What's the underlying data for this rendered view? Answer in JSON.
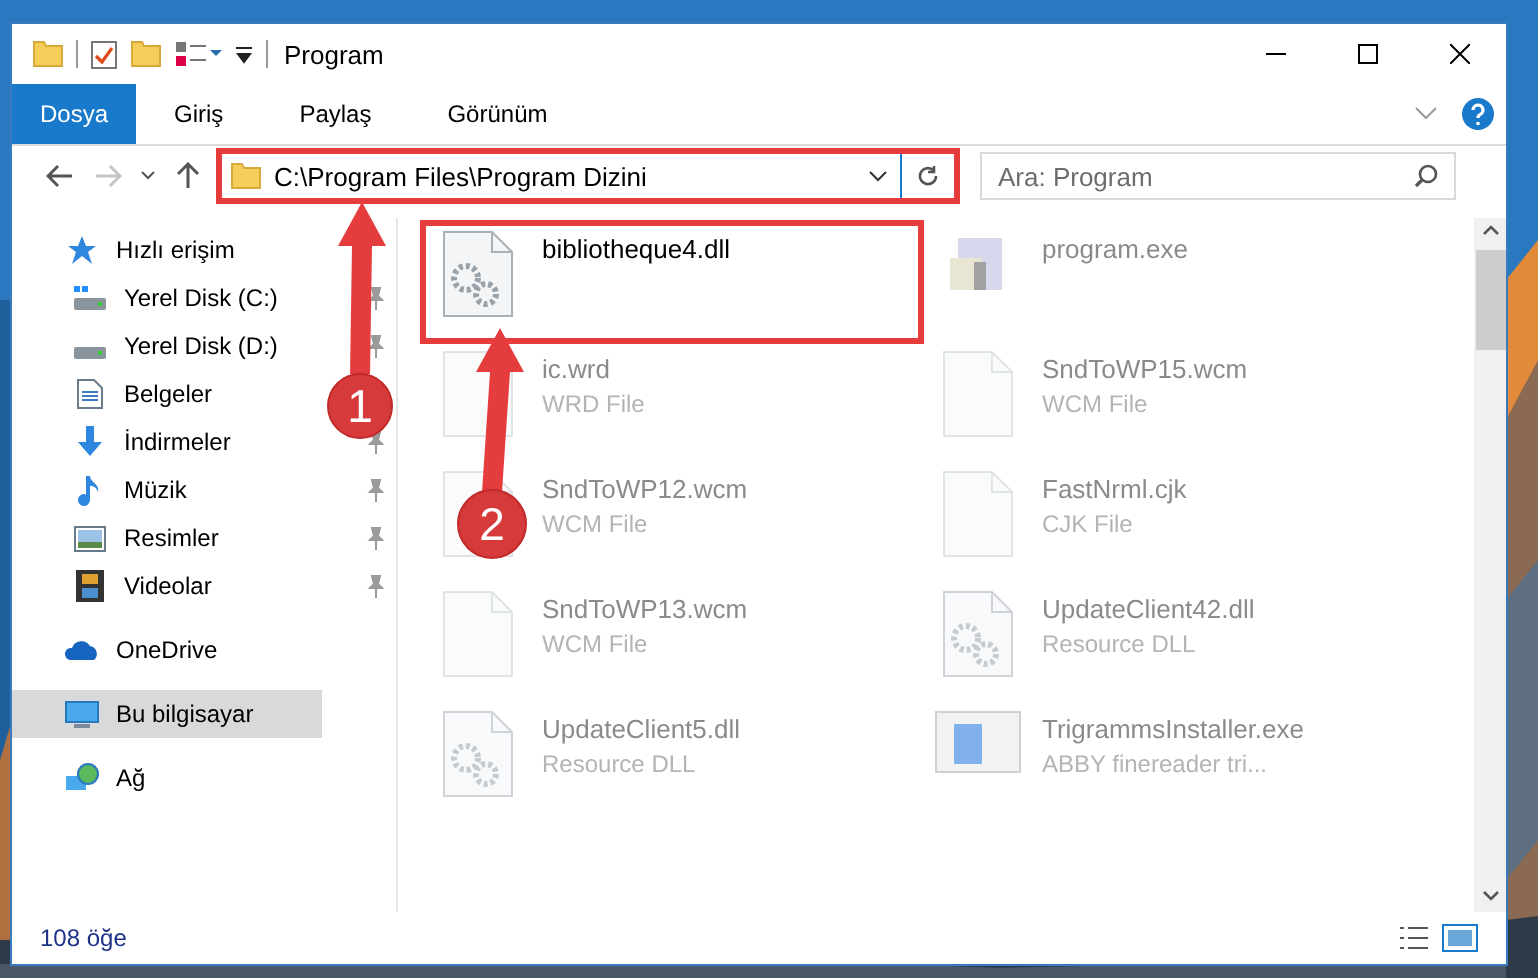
{
  "window": {
    "title": "Program"
  },
  "ribbon_tabs": [
    {
      "label": "Dosya",
      "selected": true
    },
    {
      "label": "Giriş",
      "selected": false
    },
    {
      "label": "Paylaş",
      "selected": false
    },
    {
      "label": "Görünüm",
      "selected": false
    }
  ],
  "address_bar": {
    "path": "C:\\Program Files\\Program Dizini",
    "highlighted": true
  },
  "search": {
    "placeholder": "Ara: Program"
  },
  "sidebar": [
    {
      "label": "Hızlı erişim",
      "kind": "star",
      "selected": false,
      "children": [
        {
          "label": "Yerel Disk (C:)",
          "kind": "drive-c",
          "pinned": true,
          "selected": false
        },
        {
          "label": "Yerel Disk (D:)",
          "kind": "drive",
          "pinned": true,
          "selected": false
        },
        {
          "label": "Belgeler",
          "kind": "docs",
          "selected": false
        },
        {
          "label": "İndirmeler",
          "kind": "download",
          "pinned": true,
          "selected": false
        },
        {
          "label": "Müzik",
          "kind": "music",
          "pinned": true,
          "selected": false
        },
        {
          "label": "Resimler",
          "kind": "pictures",
          "pinned": true,
          "selected": false
        },
        {
          "label": "Videolar",
          "kind": "video",
          "pinned": true,
          "selected": false
        }
      ]
    },
    {
      "label": "OneDrive",
      "kind": "cloud",
      "selected": false
    },
    {
      "label": "Bu bilgisayar",
      "kind": "computer",
      "selected": true
    },
    {
      "label": "Ağ",
      "kind": "network",
      "selected": false
    }
  ],
  "files": [
    {
      "name": "bibliotheque4.dll",
      "kind": "gear-file",
      "highlighted": true,
      "faded": false
    },
    {
      "name": "program.exe",
      "kind": "exe",
      "highlighted": false,
      "faded": true
    },
    {
      "name": "ic.wrd",
      "type": "WRD File",
      "kind": "blank-file",
      "highlighted": false,
      "faded": true
    },
    {
      "name": "SndToWP15.wcm",
      "type": "WCM File",
      "kind": "blank-file",
      "highlighted": false,
      "faded": true
    },
    {
      "name": "SndToWP12.wcm",
      "type": "WCM File",
      "kind": "blank-file",
      "highlighted": false,
      "faded": true
    },
    {
      "name": "FastNrml.cjk",
      "type": "CJK File",
      "kind": "blank-file",
      "highlighted": false,
      "faded": true
    },
    {
      "name": "SndToWP13.wcm",
      "type": "WCM File",
      "kind": "blank-file",
      "highlighted": false,
      "faded": true
    },
    {
      "name": "UpdateClient42.dll",
      "type": "Resource DLL",
      "kind": "gear-file",
      "highlighted": false,
      "faded": true
    },
    {
      "name": "UpdateClient5.dll",
      "type": "Resource DLL",
      "kind": "gear-file",
      "highlighted": false,
      "faded": true
    },
    {
      "name": "TrigrammsInstaller.exe",
      "type": "ABBY finereader tri...",
      "kind": "installer",
      "highlighted": false,
      "faded": true
    }
  ],
  "status_bar": {
    "item_count": "108 öğe"
  },
  "annotations": [
    {
      "label": "1"
    },
    {
      "label": "2"
    }
  ]
}
